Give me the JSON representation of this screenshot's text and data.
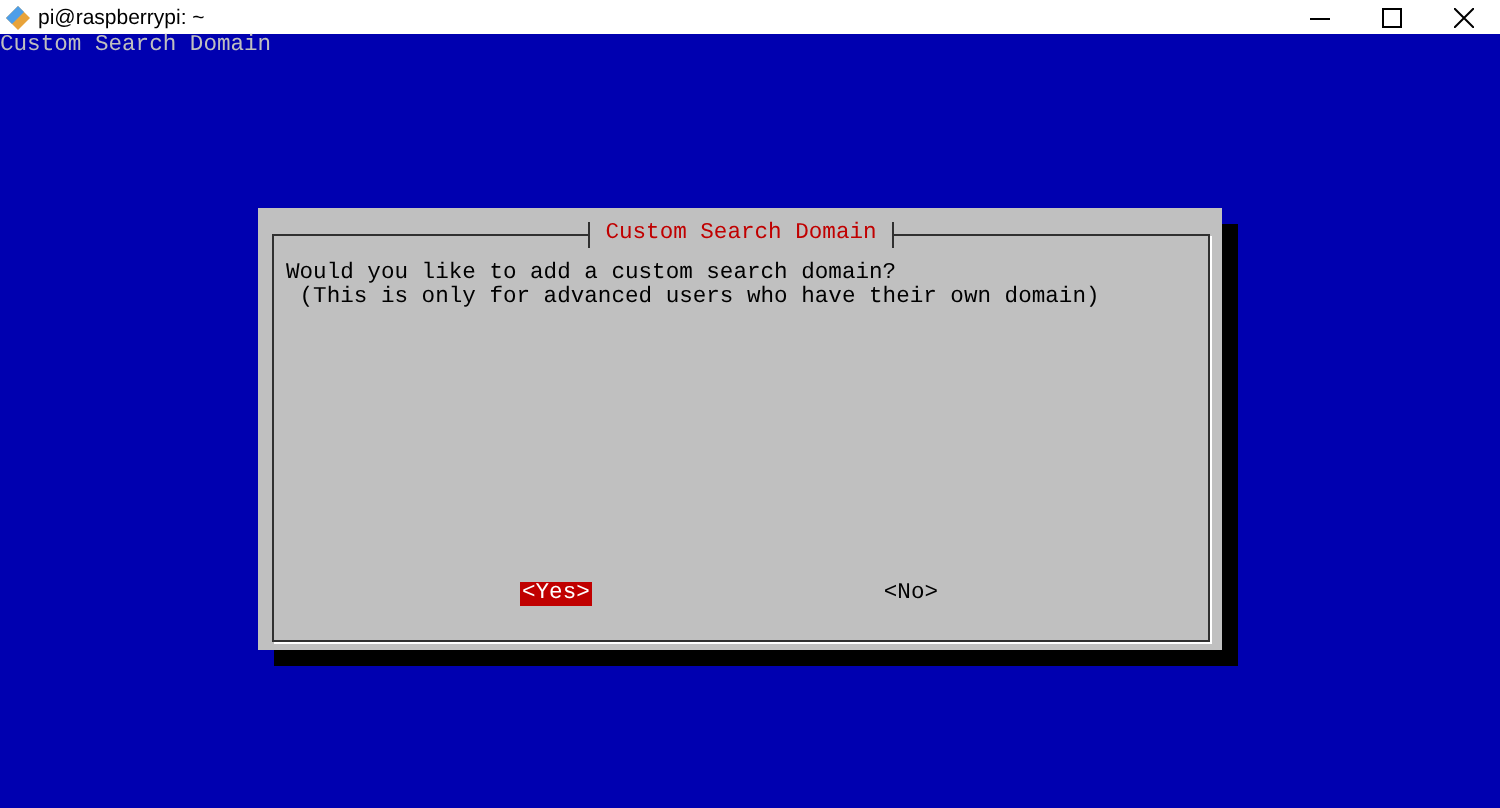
{
  "window": {
    "title": "pi@raspberrypi: ~"
  },
  "terminal": {
    "heading": "Custom Search Domain"
  },
  "dialog": {
    "title": "Custom Search Domain",
    "message": [
      "Would you like to add a custom search domain?",
      " (This is only for advanced users who have their own domain)"
    ],
    "buttons": [
      {
        "label": "<Yes>",
        "selected": true
      },
      {
        "label": "<No>",
        "selected": false
      }
    ]
  }
}
